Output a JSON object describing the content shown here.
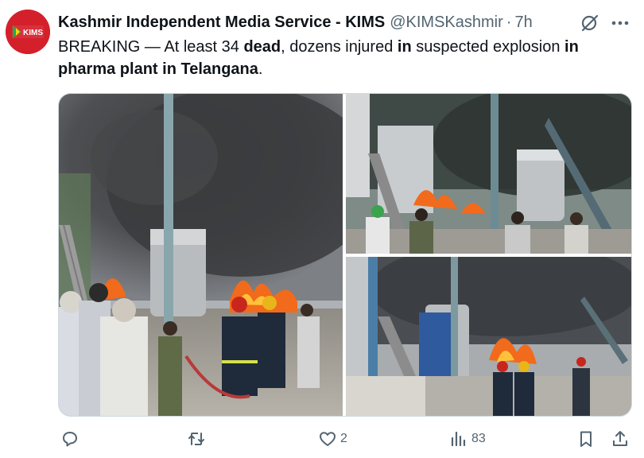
{
  "author": {
    "display_name": "Kashmir Independent Media Service - KIMS",
    "handle": "@KIMSKashmir",
    "separator": "·",
    "time_ago": "7h",
    "avatar_text": "KIMS"
  },
  "tweet": {
    "segments": [
      {
        "text": "BREAKING — At least 34 ",
        "bold": false
      },
      {
        "text": "dead",
        "bold": true
      },
      {
        "text": ", dozens injured ",
        "bold": false
      },
      {
        "text": "in",
        "bold": true
      },
      {
        "text": " suspected explosion ",
        "bold": false
      },
      {
        "text": "in",
        "bold": true
      },
      {
        "text": " ",
        "bold": false
      },
      {
        "text": "pharma plant in Telangana",
        "bold": true
      },
      {
        "text": ".",
        "bold": false
      }
    ]
  },
  "actions": {
    "reply_count": "",
    "repost_count": "",
    "like_count": "2",
    "views_count": "83"
  },
  "icons": {
    "avatar": "kims-logo-icon",
    "grok": "grok-icon",
    "more": "more-options-icon",
    "reply": "reply-icon",
    "repost": "repost-icon",
    "like": "heart-icon",
    "views": "views-chart-icon",
    "bookmark": "bookmark-icon",
    "share": "share-icon"
  },
  "colors": {
    "avatar_bg": "#d4202b",
    "text": "#0f1419",
    "muted": "#536471",
    "border": "#cfd9de",
    "fire": "#f26a1b"
  }
}
